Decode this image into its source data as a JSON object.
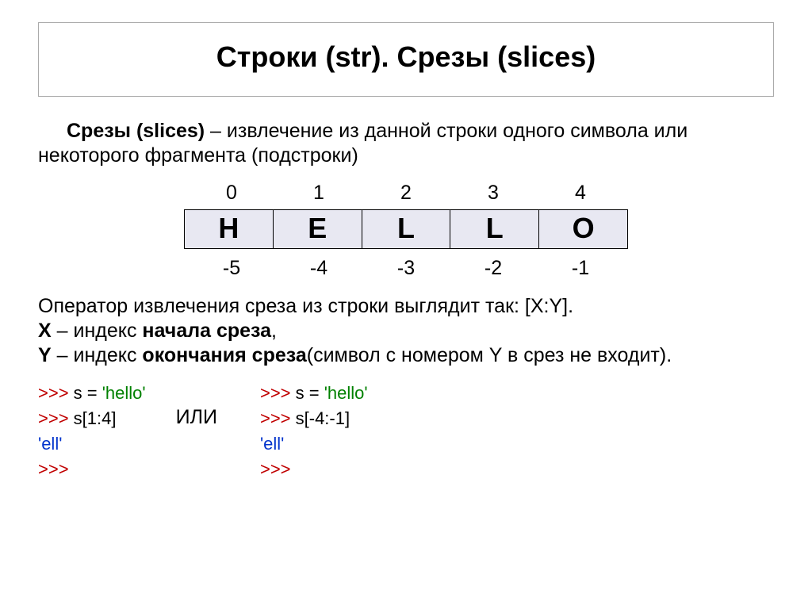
{
  "title": "Строки (str). Срезы (slices)",
  "intro": {
    "term": "Срезы (slices)",
    "rest": " – извлечение из данной строки одного символа или некоторого фрагмента (подстроки)"
  },
  "diagram": {
    "top": [
      "0",
      "1",
      "2",
      "3",
      "4"
    ],
    "chars": [
      "H",
      "E",
      "L",
      "L",
      "O"
    ],
    "bottom": [
      "-5",
      "-4",
      "-3",
      "-2",
      "-1"
    ]
  },
  "explain": {
    "l1": "Оператор извлечения среза из строки выглядит так: [X:Y].",
    "l2a": "X",
    "l2b": " – индекс ",
    "l2c": "начала среза",
    "l2d": ",",
    "l3a": "Y",
    "l3b": " – индекс ",
    "l3c": "окончания среза",
    "l3d": "(символ с номером Y в срез не входит)."
  },
  "code": {
    "left": {
      "p1": ">>> ",
      "assign_a": "s = ",
      "assign_b": "'hello'",
      "p2": ">>> ",
      "slice": "s[1:4]",
      "out": "'ell'",
      "p3": ">>>"
    },
    "sep": "ИЛИ",
    "right": {
      "p1": ">>> ",
      "assign_a": "s = ",
      "assign_b": "'hello'",
      "p2": ">>> ",
      "slice": "s[-4:-1]",
      "out": "'ell'",
      "p3": ">>>"
    }
  }
}
